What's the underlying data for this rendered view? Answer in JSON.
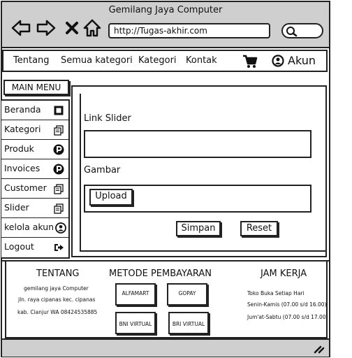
{
  "browser": {
    "title": "Gemilang Jaya Computer",
    "url": "http://Tugas-akhir.com"
  },
  "topnav": {
    "items": [
      "Tentang",
      "Semua kategori",
      "Kategori",
      "Kontak"
    ],
    "account_label": "Akun"
  },
  "sidebar": {
    "header": "MAIN MENU",
    "items": [
      {
        "label": "Beranda",
        "icon": "square-icon"
      },
      {
        "label": "Kategori",
        "icon": "copy-icon"
      },
      {
        "label": "Produk",
        "icon": "p-circle-icon"
      },
      {
        "label": "Invoices",
        "icon": "p-circle-icon"
      },
      {
        "label": "Customer",
        "icon": "copy-icon"
      },
      {
        "label": "Slider",
        "icon": "copy-icon"
      },
      {
        "label": "kelola akun",
        "icon": "user-icon"
      },
      {
        "label": "Logout",
        "icon": "logout-icon"
      }
    ]
  },
  "form": {
    "link_slider_label": "Link Slider",
    "gambar_label": "Gambar",
    "upload_label": "Upload",
    "save_label": "Simpan",
    "reset_label": "Reset"
  },
  "footer": {
    "tentang": {
      "title": "TENTANG",
      "line1": "gemilang jaya Computer",
      "line2": "jln. raya cipanas kec. cipanas",
      "line3": "kab. Cianjur WA 08424535885"
    },
    "pembayaran": {
      "title": "METODE PEMBAYARAN",
      "methods": [
        "ALFAMART",
        "GOPAY",
        "BNI VIRTUAL",
        "BRI VIRTUAL"
      ]
    },
    "jam": {
      "title": "JAM KERJA",
      "line1": "Toko Buka Setiap Hari",
      "line2": "Senin-Kamis (07.00 s/d 16.00)",
      "line3": "Jum'at-Sabtu (07.00 s/d 17.00)"
    }
  }
}
